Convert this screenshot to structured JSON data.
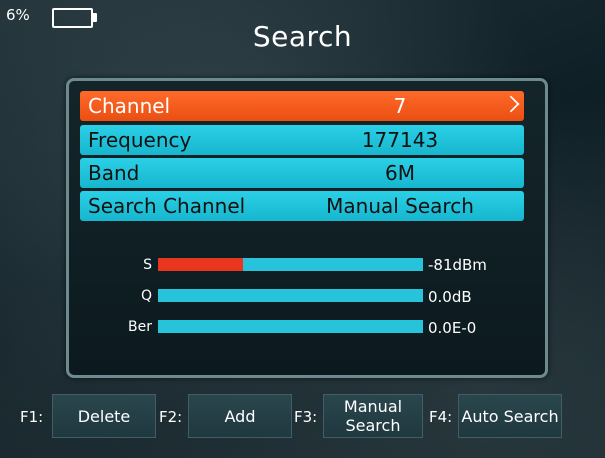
{
  "status": {
    "battery_percent": "6%",
    "battery_level": 0.06
  },
  "header": {
    "title": "Search"
  },
  "settings": [
    {
      "label": "Channel",
      "value": "7",
      "selected": true
    },
    {
      "label": "Frequency",
      "value": "177143",
      "selected": false
    },
    {
      "label": "Band",
      "value": "6M",
      "selected": false
    },
    {
      "label": "Search Channel",
      "value": "Manual Search",
      "selected": false
    }
  ],
  "meters": [
    {
      "label": "S",
      "value": "-81dBm",
      "level": 0.32
    },
    {
      "label": "Q",
      "value": "0.0dB",
      "level": 0.0
    },
    {
      "label": "Ber",
      "value": "0.0E-0",
      "level": 0.0
    }
  ],
  "function_keys": [
    {
      "key": "F1:",
      "label_line1": "Delete",
      "label_line2": ""
    },
    {
      "key": "F2:",
      "label_line1": "Add",
      "label_line2": ""
    },
    {
      "key": "F3:",
      "label_line1": "Manual",
      "label_line2": "Search"
    },
    {
      "key": "F4:",
      "label_line1": "Auto Search",
      "label_line2": ""
    }
  ],
  "colors": {
    "selected_row": "#ea4f12",
    "row": "#16b6cf",
    "meter_track": "#27c3da",
    "meter_fill": "#e8361f"
  },
  "icons": {
    "battery": "battery-icon",
    "chevron": "chevron-right-icon"
  }
}
